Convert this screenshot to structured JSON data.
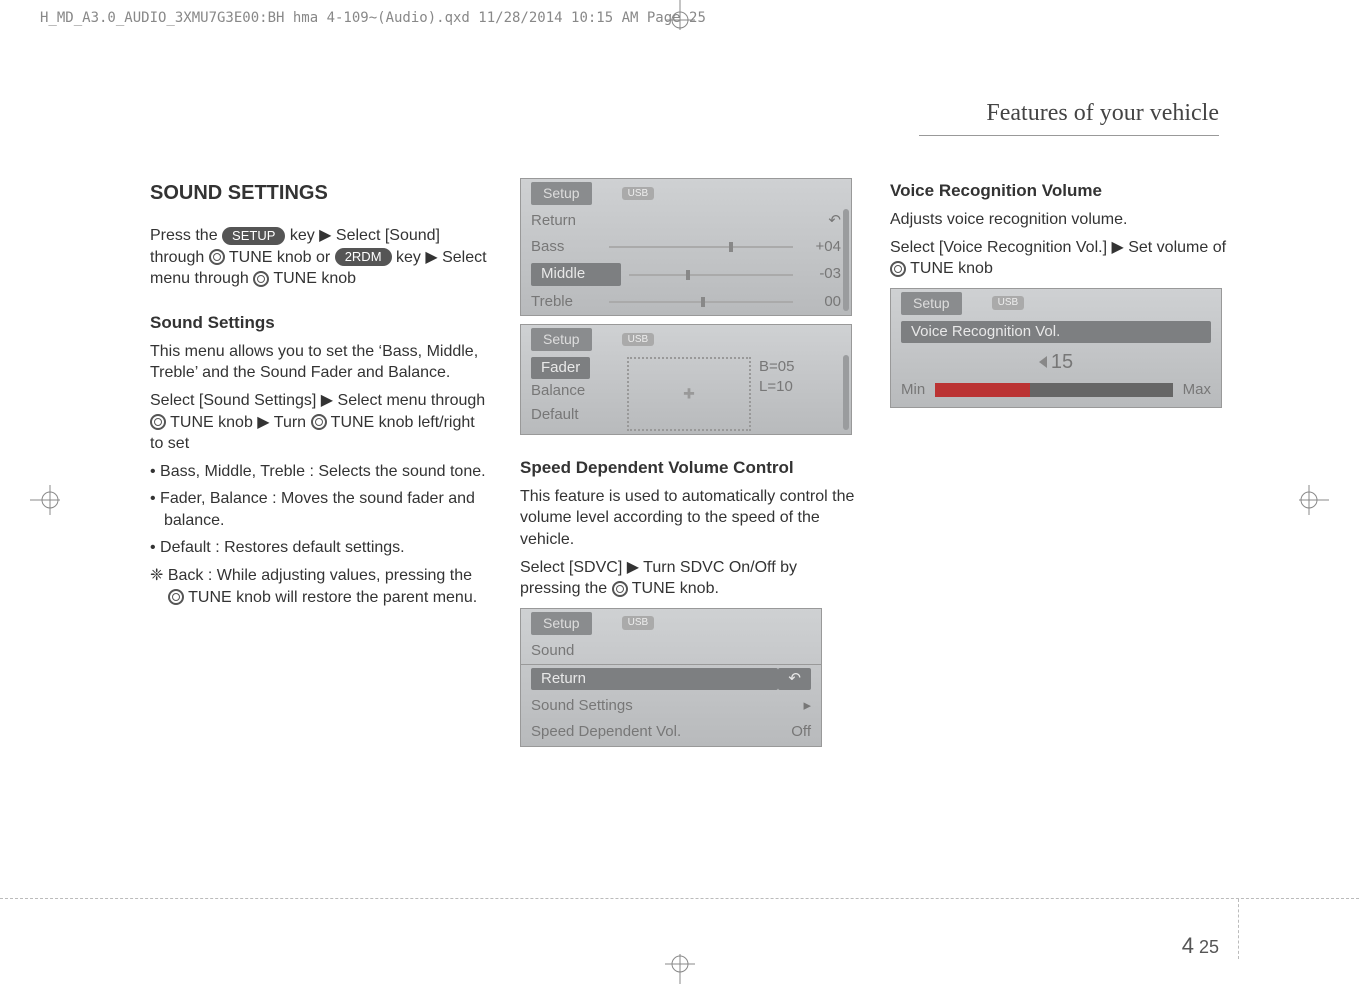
{
  "header": {
    "file_info": "H_MD_A3.0_AUDIO_3XMU7G3E00:BH hma 4-109~(Audio).qxd  11/28/2014  10:15 AM  Page 25"
  },
  "page_title": "Features of your vehicle",
  "col1": {
    "heading": "SOUND SETTINGS",
    "press_line_1a": "Press the ",
    "key_setup": "SETUP",
    "press_line_1b": " key ▶ Select [Sound] through ",
    "tune1": " TUNE knob or ",
    "key_2rdm": "2RDM",
    "press_line_1c": " key ▶ Select menu through ",
    "tune2": " TUNE knob",
    "sub_heading": "Sound Settings",
    "para1": "This menu allows you to set the ‘Bass, Middle, Treble’ and the Sound Fader and Balance.",
    "para2a": "Select [Sound Settings] ▶ Select menu through ",
    "para2b": " TUNE knob ▶ Turn ",
    "para2c": " TUNE knob left/right to set",
    "bullet1": "• Bass, Middle, Treble : Selects the sound tone.",
    "bullet2": "• Fader, Balance : Moves the sound fader and balance.",
    "bullet3": "• Default : Restores default settings.",
    "back_line_a": "❈ Back : While adjusting values, pressing the ",
    "back_line_b": " TUNE knob will restore the parent menu."
  },
  "col2": {
    "screen1": {
      "tab": "Setup",
      "pill": "USB",
      "row1": "Return",
      "row2": "Bass",
      "row2_val": "+04",
      "row3": "Middle",
      "row3_val": "-03",
      "row4": "Treble",
      "row4_val": "00"
    },
    "screen2": {
      "tab": "Setup",
      "pill": "USB",
      "row1": "Fader",
      "row1_val": "B=05",
      "row2": "Balance",
      "row2_val": "L=10",
      "row3": "Default"
    },
    "sub_heading": "Speed Dependent Volume Control",
    "para1": "This feature is used to automatically control the volume level according to the speed of the vehicle.",
    "para2a": "Select [SDVC] ▶ Turn SDVC On/Off by pressing the ",
    "para2b": " TUNE knob.",
    "screen3": {
      "tab": "Setup",
      "pill": "USB",
      "row0": "Sound",
      "row1": "Return",
      "row2": "Sound Settings",
      "row3": "Speed Dependent Vol.",
      "row3_val": "Off"
    }
  },
  "col3": {
    "heading": "Voice Recognition Volume",
    "para1": "Adjusts voice recognition volume.",
    "para2a": "Select [Voice Recognition Vol.] ▶ Set volume of ",
    "para2b": " TUNE knob",
    "screen": {
      "tab": "Setup",
      "pill": "USB",
      "row1": "Voice Recognition Vol.",
      "value": "15",
      "min": "Min",
      "max": "Max"
    }
  },
  "page_number": {
    "section": "4",
    "page": "25"
  }
}
